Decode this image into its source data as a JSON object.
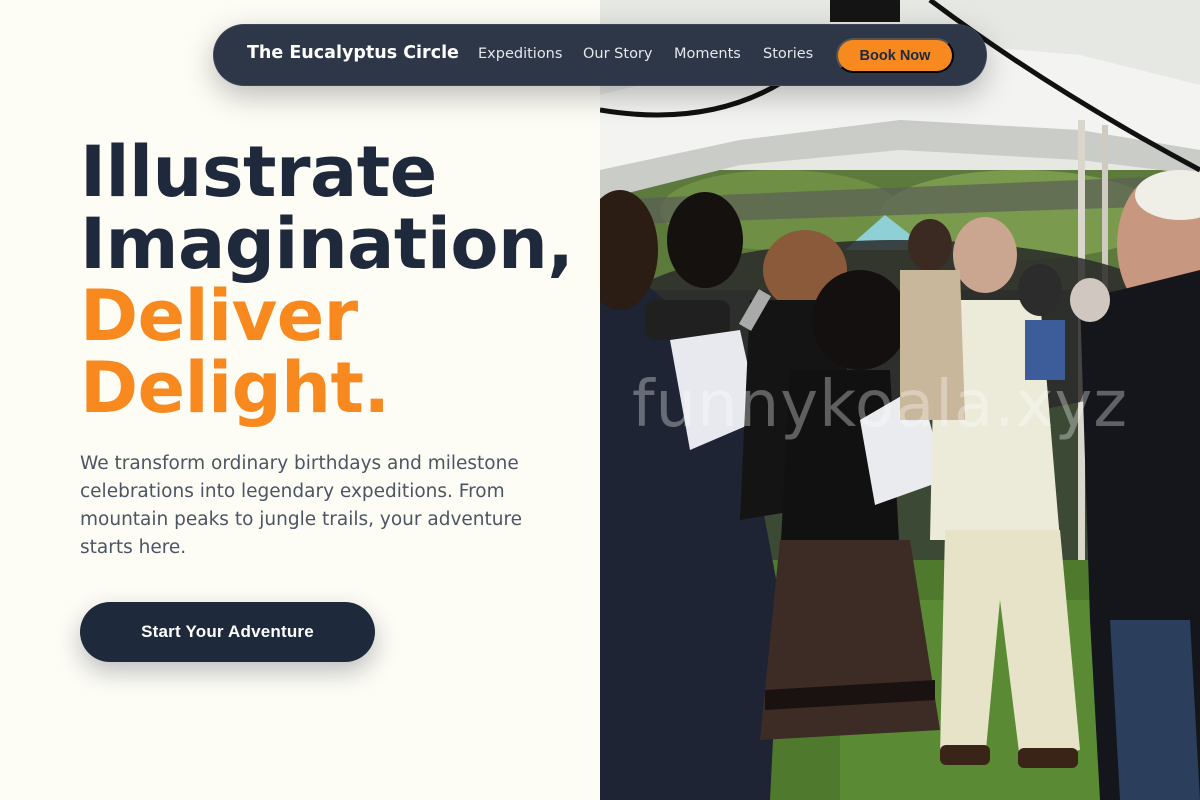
{
  "nav": {
    "brand": "The Eucalyptus Circle",
    "links": [
      "Expeditions",
      "Our Story",
      "Moments",
      "Stories"
    ],
    "cta": "Book Now"
  },
  "hero": {
    "headline_line1": "Illustrate",
    "headline_line2": "Imagination,",
    "headline_line3": "Deliver",
    "headline_line4": "Delight.",
    "description": "We transform ordinary birthdays and milestone celebrations into legendary expeditions. From mountain peaks to jungle trails, your adventure starts here.",
    "cta": "Start Your Adventure"
  },
  "photo": {
    "watermark": "funnykoala.xyz"
  },
  "colors": {
    "dark": "#1e293b",
    "accent": "#f7891f",
    "background": "#fdfcf5",
    "nav_bg": "#2d3748"
  }
}
